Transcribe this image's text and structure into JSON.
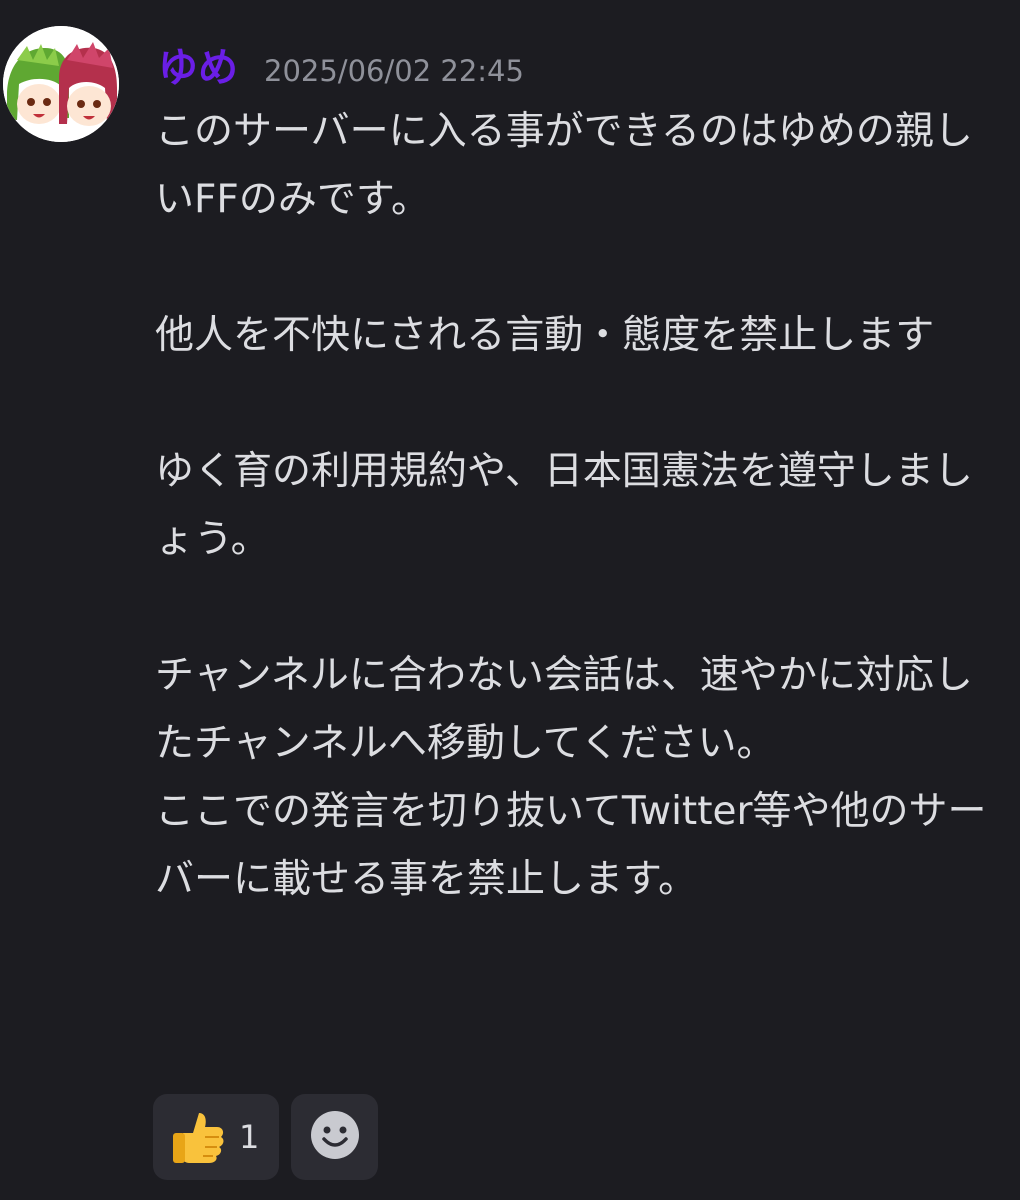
{
  "message": {
    "author": {
      "name": "ゆめ",
      "name_color": "#6a1ee6"
    },
    "timestamp": "2025/06/02 22:45",
    "paragraphs": [
      "このサーバーに入る事ができるのはゆめの親しいFFのみです。",
      "他人を不快にされる言動・態度を禁止します",
      "ゆく育の利用規約や、日本国憲法を遵守しましょう。",
      "チャンネルに合わない会話は、速やかに対応したチャンネルへ移動してください。",
      "ここでの発言を切り抜いてTwitter等や他のサーバーに載せる事を禁止します。"
    ],
    "reactions": [
      {
        "emoji": "thumbs-up-icon",
        "count": "1"
      },
      {
        "emoji": "add-reaction-icon"
      }
    ]
  },
  "colors": {
    "background": "#1c1c21",
    "text": "#dcdde1",
    "timestamp": "#8f919a",
    "reaction_bg": "#2c2c33"
  }
}
